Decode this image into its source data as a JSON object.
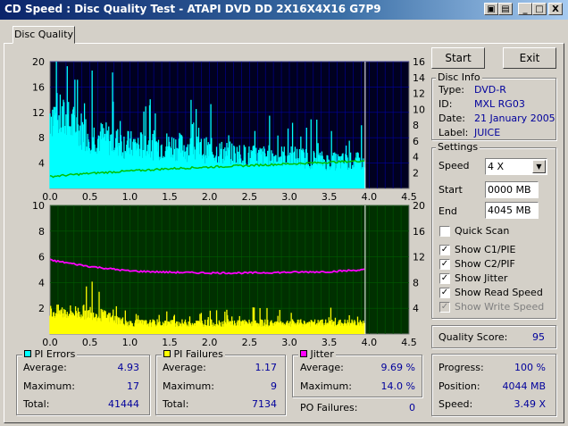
{
  "window": {
    "title": "CD Speed : Disc Quality Test - ATAPI   DVD DD 2X16X4X16 G7P9",
    "buttons": {
      "minimize": "_",
      "maximize": "□",
      "close": "X"
    }
  },
  "tabs": [
    {
      "label": "Disc Quality"
    }
  ],
  "buttons": {
    "start": "Start",
    "exit": "Exit"
  },
  "disc_info": {
    "title": "Disc Info",
    "type_label": "Type:",
    "type_value": "DVD-R",
    "id_label": "ID:",
    "id_value": "MXL RG03",
    "date_label": "Date:",
    "date_value": "21 January 2005",
    "label_label": "Label:",
    "label_value": "JUICE"
  },
  "settings": {
    "title": "Settings",
    "speed_label": "Speed",
    "speed_value": "4 X",
    "start_label": "Start",
    "start_value": "0000 MB",
    "end_label": "End",
    "end_value": "4045 MB",
    "quick_scan": "Quick Scan",
    "show_c1": "Show C1/PIE",
    "show_c2": "Show C2/PIF",
    "show_jitter": "Show Jitter",
    "show_read": "Show Read Speed",
    "show_write": "Show Write Speed"
  },
  "quality": {
    "label": "Quality Score:",
    "value": "95"
  },
  "progress": {
    "progress_label": "Progress:",
    "progress_value": "100 %",
    "position_label": "Position:",
    "position_value": "4044 MB",
    "speed_label": "Speed:",
    "speed_value": "3.49 X"
  },
  "pi_errors": {
    "title": "PI Errors",
    "avg_label": "Average:",
    "avg": "4.93",
    "max_label": "Maximum:",
    "max": "17",
    "total_label": "Total:",
    "total": "41444"
  },
  "pi_failures": {
    "title": "PI Failures",
    "avg_label": "Average:",
    "avg": "1.17",
    "max_label": "Maximum:",
    "max": "9",
    "total_label": "Total:",
    "total": "7134"
  },
  "jitter": {
    "title": "Jitter",
    "avg_label": "Average:",
    "avg": "9.69 %",
    "max_label": "Maximum:",
    "max": "14.0 %"
  },
  "po_failures": {
    "label": "PO Failures:",
    "value": "0"
  },
  "colors": {
    "pie": "#00ffff",
    "pif": "#ffff00",
    "jitter": "#ff00ff",
    "speed": "#00c000",
    "top_bg": "#000020",
    "bottom_bg": "#003000",
    "grid": "#0000a0"
  },
  "chart_data": [
    {
      "type": "bar",
      "x_ticks": [
        "0.0",
        "0.5",
        "1.0",
        "1.5",
        "2.0",
        "2.5",
        "3.0",
        "3.5",
        "4.0",
        "4.5"
      ],
      "y_ticks_left": [
        "20",
        "16",
        "12",
        "8",
        "4"
      ],
      "y_ticks_right": [
        "16",
        "14",
        "12",
        "10",
        "8",
        "6",
        "4",
        "2"
      ],
      "xlim": [
        0,
        4.5
      ],
      "ylim": [
        0,
        20
      ],
      "y2lim": [
        0,
        16
      ],
      "series": [
        {
          "name": "PI Errors",
          "x": [
            0.0,
            0.5,
            1.0,
            1.5,
            2.0,
            2.5,
            3.0,
            3.5,
            3.95
          ],
          "values": [
            14,
            10,
            8,
            8,
            7,
            6,
            6,
            5,
            5
          ]
        },
        {
          "name": "Read Speed",
          "x": [
            0.0,
            0.5,
            1.0,
            1.5,
            2.0,
            2.5,
            3.0,
            3.5,
            3.95
          ],
          "values": [
            1.5,
            1.9,
            2.2,
            2.5,
            2.7,
            2.9,
            3.1,
            3.3,
            3.5
          ]
        }
      ]
    },
    {
      "type": "bar",
      "x_ticks": [
        "0.0",
        "0.5",
        "1.0",
        "1.5",
        "2.0",
        "2.5",
        "3.0",
        "3.5",
        "4.0",
        "4.5"
      ],
      "y_ticks_left": [
        "10",
        "8",
        "6",
        "4",
        "2"
      ],
      "y_ticks_right": [
        "20",
        "16",
        "12",
        "8",
        "4"
      ],
      "xlim": [
        0,
        4.5
      ],
      "ylim": [
        0,
        10
      ],
      "y2lim": [
        0,
        20
      ],
      "series": [
        {
          "name": "PI Failures",
          "x": [
            0.0,
            0.5,
            1.0,
            1.5,
            2.0,
            2.5,
            3.0,
            3.5,
            3.95
          ],
          "values": [
            2,
            2,
            1,
            1,
            1,
            1,
            1,
            1,
            1
          ]
        },
        {
          "name": "Jitter",
          "x": [
            0.0,
            0.5,
            1.0,
            1.5,
            2.0,
            2.5,
            3.0,
            3.5,
            3.95
          ],
          "values": [
            11.5,
            10.5,
            9.8,
            9.6,
            9.5,
            9.5,
            9.6,
            9.7,
            10.0
          ]
        }
      ]
    }
  ]
}
